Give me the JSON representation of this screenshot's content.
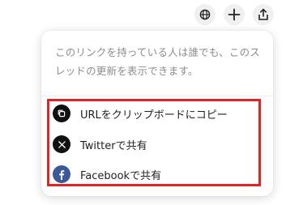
{
  "toolbar": {
    "buttons": [
      {
        "icon": "globe-icon"
      },
      {
        "icon": "plus-icon"
      },
      {
        "icon": "share-icon"
      }
    ]
  },
  "share_menu": {
    "description": "このリンクを持っている人は誰でも、このスレッドの更新を表示できます。",
    "items": [
      {
        "label": "URLをクリップボードにコピー",
        "icon": "copy-icon"
      },
      {
        "label": "Twitterで共有",
        "icon": "x-twitter-icon"
      },
      {
        "label": "Facebookで共有",
        "icon": "facebook-icon",
        "color": "#3b5998"
      }
    ],
    "highlight_color": "#e02424"
  }
}
